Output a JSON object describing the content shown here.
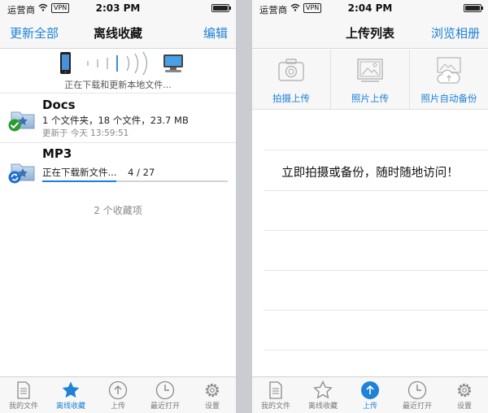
{
  "left": {
    "status": {
      "carrier": "运营商",
      "vpn": "VPN",
      "time": "2:03 PM"
    },
    "nav": {
      "left": "更新全部",
      "title": "离线收藏",
      "right": "编辑"
    },
    "sync_text": "正在下载和更新本地文件...",
    "items": [
      {
        "title": "Docs",
        "subtitle": "1 个文件夹，18 个文件，23.7 MB",
        "meta": "更新于 今天 13:59:51",
        "status_icon": "green-check-icon"
      },
      {
        "title": "MP3",
        "subtitle": "正在下载新文件...",
        "progress_text": "4 / 27",
        "progress_fraction": 0.4,
        "status_icon": "blue-sync-icon"
      }
    ],
    "favorites_count": "2 个收藏项",
    "tabs": [
      {
        "label": "我的文件",
        "icon": "document-icon",
        "active": false
      },
      {
        "label": "离线收藏",
        "icon": "star-icon",
        "active": true
      },
      {
        "label": "上传",
        "icon": "upload-icon",
        "active": false
      },
      {
        "label": "最近打开",
        "icon": "clock-icon",
        "active": false
      },
      {
        "label": "设置",
        "icon": "gear-icon",
        "active": false
      }
    ]
  },
  "right": {
    "status": {
      "carrier": "运营商",
      "vpn": "VPN",
      "time": "2:04 PM"
    },
    "nav": {
      "title": "上传列表",
      "right": "浏览相册"
    },
    "upload_options": [
      {
        "label": "拍摄上传",
        "icon": "camera-icon"
      },
      {
        "label": "照片上传",
        "icon": "photos-icon"
      },
      {
        "label": "照片自动备份",
        "icon": "cloud-backup-icon"
      }
    ],
    "promo": "立即拍摄或备份，随时随地访问！",
    "tabs": [
      {
        "label": "我的文件",
        "icon": "document-icon",
        "active": false
      },
      {
        "label": "离线收藏",
        "icon": "star-icon",
        "active": false
      },
      {
        "label": "上传",
        "icon": "upload-icon",
        "active": true
      },
      {
        "label": "最近打开",
        "icon": "clock-icon",
        "active": false
      },
      {
        "label": "设置",
        "icon": "gear-icon",
        "active": false
      }
    ]
  },
  "colors": {
    "accent": "#1f82d6",
    "progress": "#1a7fe0",
    "check": "#2a9d2f"
  }
}
